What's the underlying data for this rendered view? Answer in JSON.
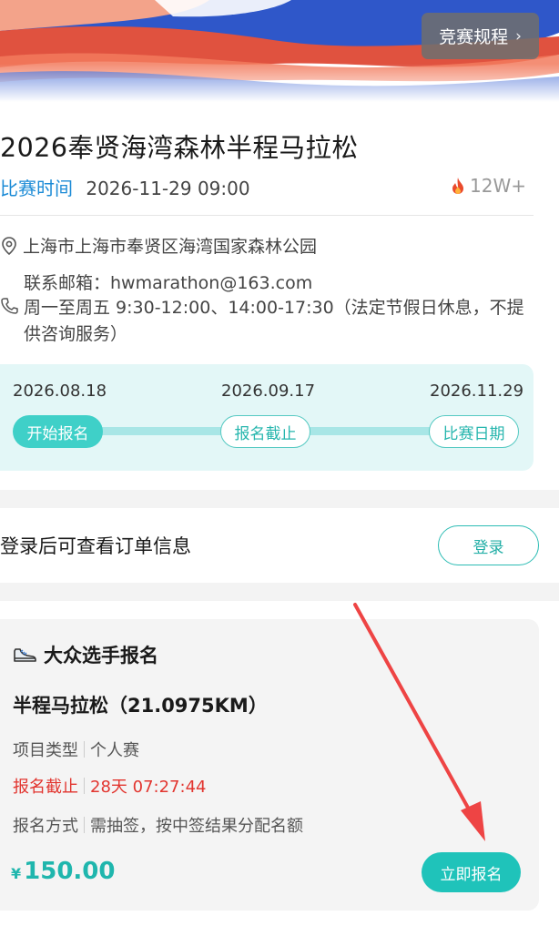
{
  "header": {
    "rules_button": "竞赛规程",
    "rules_chevron": "›"
  },
  "event": {
    "title": "2026奉贤海湾森林半程马拉松",
    "time_label": "比赛时间",
    "time_value": "2026-11-29 09:00",
    "popularity": "12W+",
    "address": "上海市上海市奉贤区海湾国家森林公园",
    "email": "联系邮箱：hwmarathon@163.com",
    "hours": "周一至周五 9:30-12:00、14:00-17:30（法定节假日休息，不提供咨询服务）"
  },
  "timeline": {
    "steps": [
      {
        "date": "2026.08.18",
        "label": "开始报名"
      },
      {
        "date": "2026.09.17",
        "label": "报名截止"
      },
      {
        "date": "2026.11.29",
        "label": "比赛日期"
      }
    ]
  },
  "login": {
    "text": "登录后可查看订单信息",
    "button": "登录"
  },
  "entry": {
    "category": "大众选手报名",
    "name": "半程马拉松（21.0975KM）",
    "type_label": "项目类型",
    "type_value": "个人赛",
    "deadline_label": "报名截止",
    "deadline_value": "28天 07:27:44",
    "method_label": "报名方式",
    "method_value": "需抽签，按中签结果分配名额",
    "currency": "¥",
    "price": "150.00",
    "signup_button": "立即报名"
  },
  "colors": {
    "accent": "#1fc3ba",
    "link_blue": "#1c8bd6",
    "deadline_red": "#e2352f",
    "arrow_red": "#ee4444"
  },
  "icons": [
    "fire-icon",
    "location-pin-icon",
    "phone-icon",
    "sneaker-icon",
    "chevron-right-icon"
  ]
}
